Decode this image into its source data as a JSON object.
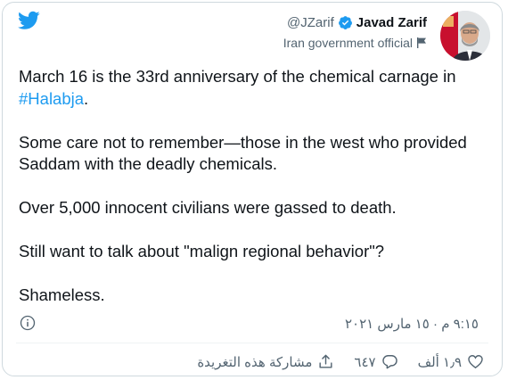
{
  "header": {
    "handle": "@JZarif",
    "display_name": "Javad Zarif",
    "label": "Iran government official"
  },
  "tweet": {
    "line1_text": "March 16 is the 33rd anniversary of the chemical carnage in",
    "hashtag": "#Halabja",
    "hashtag_suffix": ".",
    "line2_text": "Some care not to remember—those in the west who provided Saddam with the deadly chemicals.",
    "line3_text": "Over 5,000 innocent civilians were gassed to death.",
    "line4_text": "Still want to talk about \"malign regional behavior\"?",
    "line5_text": "Shameless."
  },
  "meta": {
    "timestamp": "٩:١٥ م · ١٥ مارس ٢٠٢١"
  },
  "actions": {
    "like_count": "١٫٩ ألف",
    "reply_count": "٦٤٧",
    "share_label": "مشاركة هذه التغريدة"
  },
  "colors": {
    "accent": "#1d9bf0",
    "text": "#0f1419",
    "muted": "#536471",
    "border": "#cfd9de"
  },
  "icons": [
    "twitter-logo-icon",
    "verified-badge-icon",
    "government-flag-icon",
    "info-icon",
    "like-heart-icon",
    "reply-bubble-icon",
    "share-icon"
  ]
}
